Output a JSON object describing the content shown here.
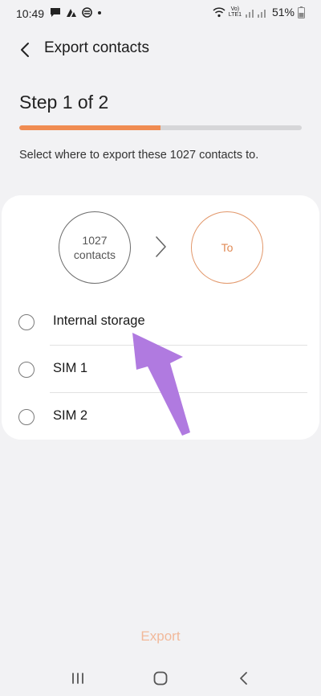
{
  "status_bar": {
    "time": "10:49",
    "volte_line1": "Vo)",
    "volte_line2": "LTE1",
    "battery_percent": "51%"
  },
  "header": {
    "title": "Export contacts"
  },
  "step": {
    "title": "Step 1 of 2",
    "progress": 0.5,
    "instruction": "Select where to export these 1027 contacts to."
  },
  "flow": {
    "from_line1": "1027",
    "from_line2": "contacts",
    "to_label": "To"
  },
  "options": [
    {
      "label": "Internal storage",
      "selected": false
    },
    {
      "label": "SIM 1",
      "selected": false
    },
    {
      "label": "SIM 2",
      "selected": false
    }
  ],
  "footer": {
    "export_label": "Export"
  },
  "colors": {
    "accent": "#f08c52",
    "annotation": "#b07ae0",
    "background": "#f2f2f4"
  }
}
